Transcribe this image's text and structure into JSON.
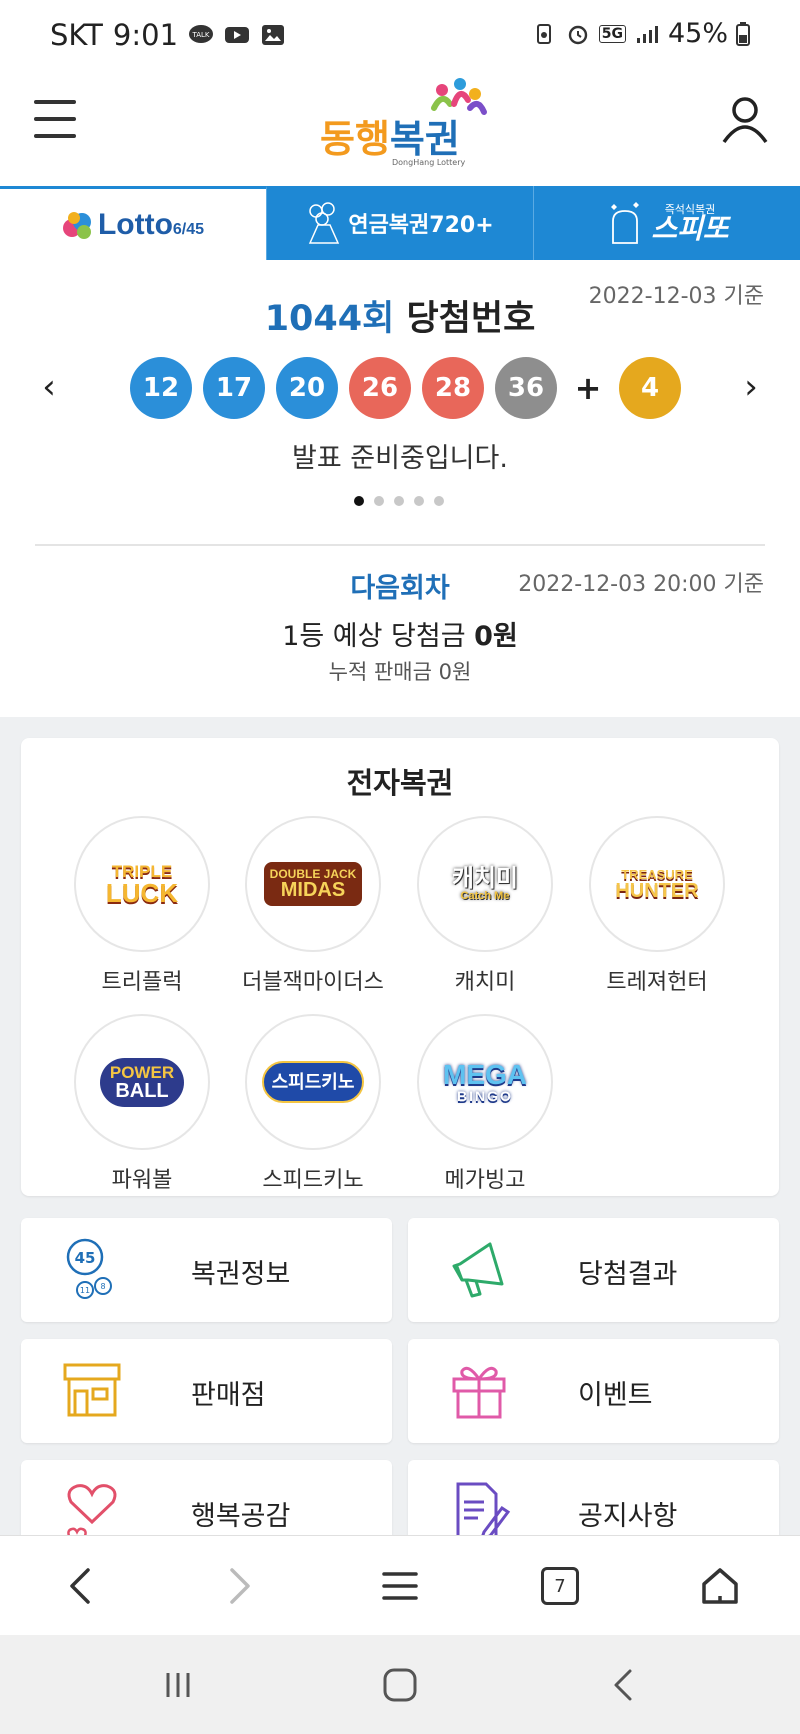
{
  "status_bar": {
    "carrier": "SKT",
    "time": "9:01",
    "network": "5G",
    "battery": "45%"
  },
  "header": {
    "logo_text_1": "동행",
    "logo_text_2": "복권",
    "logo_sub": "DongHang Lottery",
    "colors": {
      "brand_orange": "#f39a1e",
      "brand_blue": "#1f6fb7"
    }
  },
  "tabs": [
    {
      "label": "Lotto",
      "sub": "6/45",
      "active": true
    },
    {
      "label": "연금복권720+",
      "active": false
    },
    {
      "label": "스피또",
      "badge": "즉석식복권",
      "active": false
    }
  ],
  "draw": {
    "date": "2022-12-03 기준",
    "round": "1044회",
    "title_suffix": "당첨번호",
    "numbers": [
      "12",
      "17",
      "20",
      "26",
      "28",
      "36"
    ],
    "number_colors": [
      "#2b8fd9",
      "#2b8fd9",
      "#2b8fd9",
      "#e8675a",
      "#e8675a",
      "#8e8e8e"
    ],
    "plus": "+",
    "bonus": "4",
    "bonus_color": "#e5a81e",
    "announce": "발표 준비중입니다.",
    "prev_arrow": "‹",
    "next_arrow": "›"
  },
  "next_round": {
    "date": "2022-12-03 20:00 기준",
    "title": "다음회차",
    "prize_label": "1등 예상 당첨금",
    "prize_value": "0원",
    "sales": "누적 판매금 0원"
  },
  "electronic": {
    "title": "전자복권",
    "games": [
      {
        "name": "트리플럭",
        "logo": [
          "TRIPLE",
          "LUCK"
        ]
      },
      {
        "name": "더블잭마이더스",
        "logo": [
          "DOUBLE JACK",
          "MIDAS"
        ]
      },
      {
        "name": "캐치미",
        "logo": [
          "캐치미",
          "Catch Me"
        ]
      },
      {
        "name": "트레져헌터",
        "logo": [
          "TREASURE",
          "HUNTER"
        ]
      },
      {
        "name": "파워볼",
        "logo": [
          "POWER",
          "BALL"
        ]
      },
      {
        "name": "스피드키노",
        "logo": [
          "스피드키노"
        ]
      },
      {
        "name": "메가빙고",
        "logo": [
          "MEGA",
          "BINGO"
        ]
      }
    ]
  },
  "menu": [
    {
      "label": "복권정보",
      "icon": "lottery-info-icon"
    },
    {
      "label": "당첨결과",
      "icon": "megaphone-icon"
    },
    {
      "label": "판매점",
      "icon": "store-icon"
    },
    {
      "label": "이벤트",
      "icon": "gift-icon"
    },
    {
      "label": "행복공감",
      "icon": "hearts-icon"
    },
    {
      "label": "공지사항",
      "icon": "notice-icon"
    }
  ],
  "browser_nav": {
    "tab_count": "7"
  }
}
